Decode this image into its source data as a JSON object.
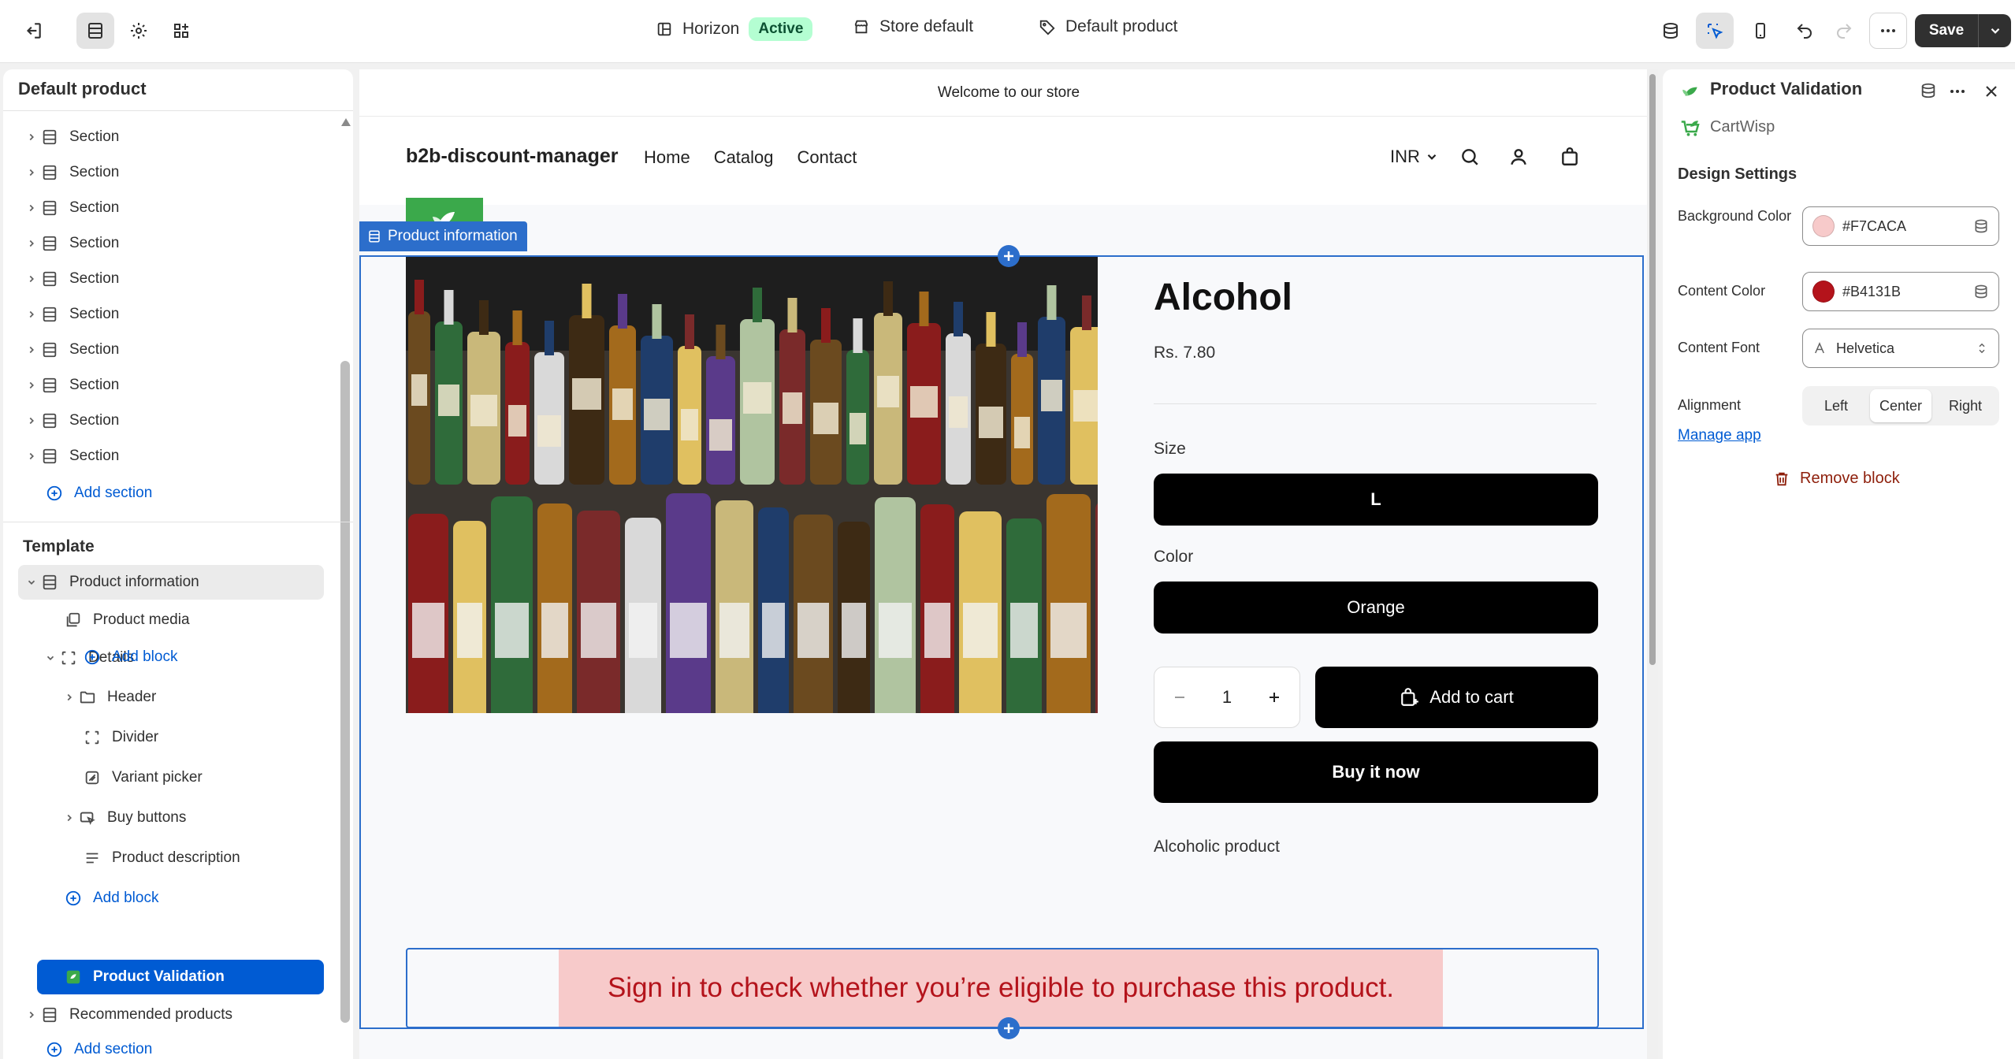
{
  "topbar": {
    "theme_name": "Horizon",
    "theme_status": "Active",
    "market": "Store default",
    "template": "Default product",
    "save_label": "Save"
  },
  "left_panel": {
    "title": "Default product",
    "sections": [
      "Section",
      "Section",
      "Section",
      "Section",
      "Section",
      "Section",
      "Section",
      "Section",
      "Section",
      "Section"
    ],
    "add_section_label": "Add section",
    "template_heading": "Template",
    "product_information": "Product information",
    "product_media": "Product media",
    "details": "Details",
    "add_block_inner": "Add block",
    "header": "Header",
    "divider": "Divider",
    "variant_picker": "Variant picker",
    "buy_buttons": "Buy buttons",
    "product_description": "Product description",
    "add_block_outer": "Add block",
    "product_validation": "Product Validation",
    "recommended_products": "Recommended products",
    "add_section_bottom": "Add section"
  },
  "preview": {
    "announcement": "Welcome to our store",
    "brand": "b2b-discount-manager",
    "nav": [
      "Home",
      "Catalog",
      "Contact"
    ],
    "currency": "INR",
    "block_tag": "Product information",
    "product": {
      "title": "Alcohol",
      "price": "Rs. 7.80",
      "size_label": "Size",
      "size_value": "L",
      "color_label": "Color",
      "color_value": "Orange",
      "quantity": "1",
      "add_to_cart": "Add to cart",
      "buy_now": "Buy it now",
      "description": "Alcoholic product"
    },
    "validation_message": "Sign in to check whether you’re eligible to purchase this product."
  },
  "right_panel": {
    "title": "Product Validation",
    "app_name": "CartWisp",
    "design_heading": "Design Settings",
    "background_color_label": "Background Color",
    "background_color": "#F7CACA",
    "content_color_label": "Content Color",
    "content_color": "#B4131B",
    "content_font_label": "Content Font",
    "content_font": "Helvetica",
    "alignment_label": "Alignment",
    "alignment_options": [
      "Left",
      "Center",
      "Right"
    ],
    "alignment_selected": "Center",
    "manage_app": "Manage app",
    "remove_block": "Remove block"
  },
  "colors": {
    "accent_blue": "#2c6ecb",
    "link_blue": "#005bd3",
    "validation_bg": "#F7CACA",
    "validation_text": "#B4131B",
    "active_badge": "#b4fed2",
    "remove_red": "#8e1f0b"
  }
}
